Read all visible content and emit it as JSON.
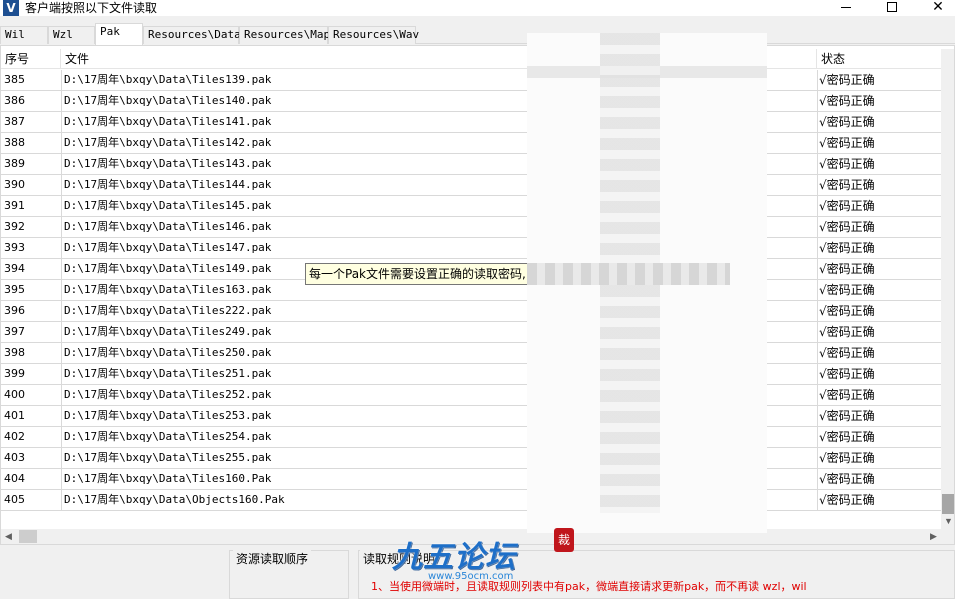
{
  "window": {
    "title": "客户端按照以下文件读取",
    "icon_letter": "V"
  },
  "tabs": [
    {
      "label": "Wil",
      "active": false
    },
    {
      "label": "Wzl",
      "active": false
    },
    {
      "label": "Pak",
      "active": true
    },
    {
      "label": "Resources\\Data",
      "active": false
    },
    {
      "label": "Resources\\Map",
      "active": false
    },
    {
      "label": "Resources\\Wav",
      "active": false
    }
  ],
  "table": {
    "columns": [
      "序号",
      "文件",
      "状态"
    ],
    "rows": [
      {
        "idx": "385",
        "file": "D:\\17周年\\bxqy\\Data\\Tiles139.pak",
        "status": "√密码正确"
      },
      {
        "idx": "386",
        "file": "D:\\17周年\\bxqy\\Data\\Tiles140.pak",
        "status": "√密码正确"
      },
      {
        "idx": "387",
        "file": "D:\\17周年\\bxqy\\Data\\Tiles141.pak",
        "status": "√密码正确"
      },
      {
        "idx": "388",
        "file": "D:\\17周年\\bxqy\\Data\\Tiles142.pak",
        "status": "√密码正确"
      },
      {
        "idx": "389",
        "file": "D:\\17周年\\bxqy\\Data\\Tiles143.pak",
        "status": "√密码正确"
      },
      {
        "idx": "390",
        "file": "D:\\17周年\\bxqy\\Data\\Tiles144.pak",
        "status": "√密码正确"
      },
      {
        "idx": "391",
        "file": "D:\\17周年\\bxqy\\Data\\Tiles145.pak",
        "status": "√密码正确"
      },
      {
        "idx": "392",
        "file": "D:\\17周年\\bxqy\\Data\\Tiles146.pak",
        "status": "√密码正确"
      },
      {
        "idx": "393",
        "file": "D:\\17周年\\bxqy\\Data\\Tiles147.pak",
        "status": "√密码正确"
      },
      {
        "idx": "394",
        "file": "D:\\17周年\\bxqy\\Data\\Tiles149.pak",
        "status": "√密码正确"
      },
      {
        "idx": "395",
        "file": "D:\\17周年\\bxqy\\Data\\Tiles163.pak",
        "status": "√密码正确"
      },
      {
        "idx": "396",
        "file": "D:\\17周年\\bxqy\\Data\\Tiles222.pak",
        "status": "√密码正确"
      },
      {
        "idx": "397",
        "file": "D:\\17周年\\bxqy\\Data\\Tiles249.pak",
        "status": "√密码正确"
      },
      {
        "idx": "398",
        "file": "D:\\17周年\\bxqy\\Data\\Tiles250.pak",
        "status": "√密码正确"
      },
      {
        "idx": "399",
        "file": "D:\\17周年\\bxqy\\Data\\Tiles251.pak",
        "status": "√密码正确"
      },
      {
        "idx": "400",
        "file": "D:\\17周年\\bxqy\\Data\\Tiles252.pak",
        "status": "√密码正确"
      },
      {
        "idx": "401",
        "file": "D:\\17周年\\bxqy\\Data\\Tiles253.pak",
        "status": "√密码正确"
      },
      {
        "idx": "402",
        "file": "D:\\17周年\\bxqy\\Data\\Tiles254.pak",
        "status": "√密码正确"
      },
      {
        "idx": "403",
        "file": "D:\\17周年\\bxqy\\Data\\Tiles255.pak",
        "status": "√密码正确"
      },
      {
        "idx": "404",
        "file": "D:\\17周年\\bxqy\\Data\\Tiles160.Pak",
        "status": "√密码正确"
      },
      {
        "idx": "405",
        "file": "D:\\17周年\\bxqy\\Data\\Objects160.Pak",
        "status": "√密码正确"
      }
    ]
  },
  "tooltip": {
    "text": "每一个Pak文件需要设置正确的读取密码,"
  },
  "bottom": {
    "group1_label": "资源读取顺序",
    "group2_label": "读取规则说明",
    "rule_text": "1、当使用微端时，且读取规则列表中有pak，微端直接请求更新pak，而不再读 wzl，wil"
  },
  "watermark": {
    "text": "九五论坛",
    "seal": "裁",
    "url": "www.95ocm.com"
  },
  "colors": {
    "accent_blue": "#1d4f91",
    "rule_red": "#e00000",
    "tooltip_bg": "#ffffe1"
  },
  "icons": {
    "minimize": "minimize-icon",
    "maximize": "maximize-icon",
    "close": "close-icon"
  }
}
